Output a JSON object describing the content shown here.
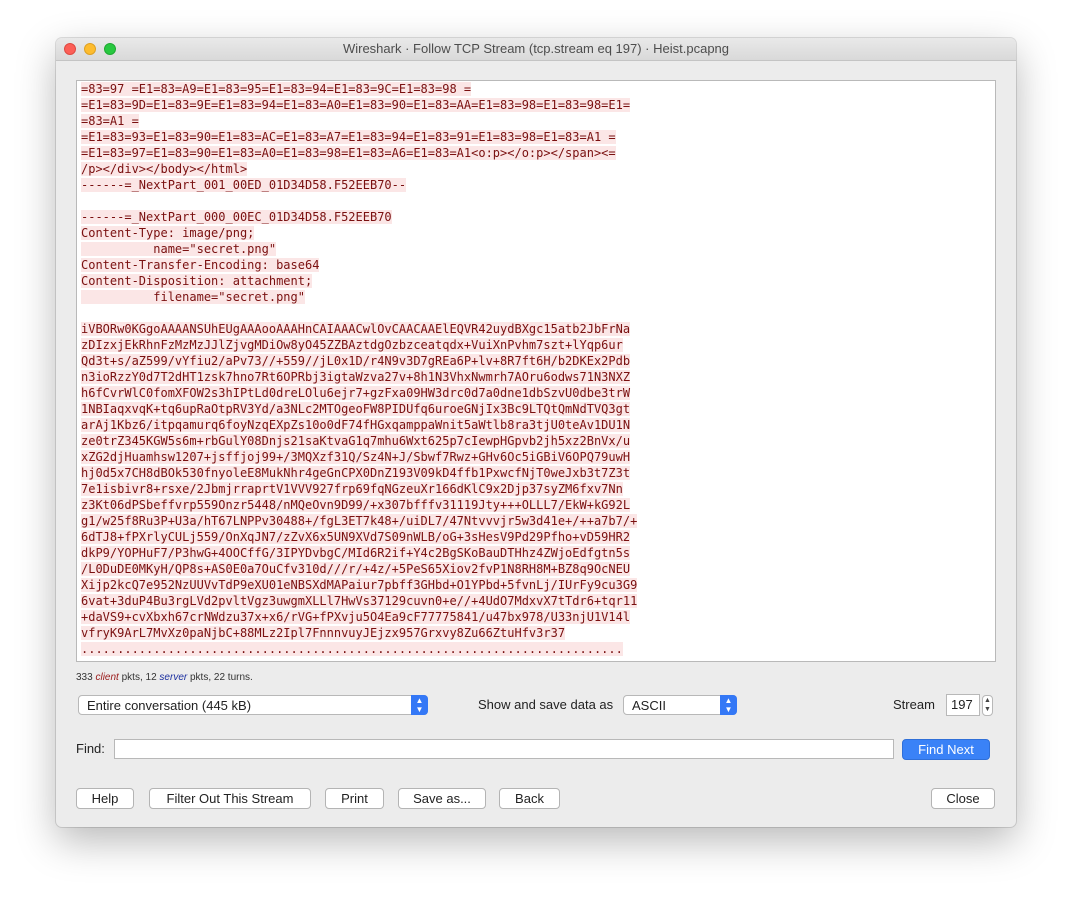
{
  "window": {
    "title": "Wireshark · Follow TCP Stream (tcp.stream eq 197) · Heist.pcapng"
  },
  "stream_lines": [
    "=83=97 =E1=83=A9=E1=83=95=E1=83=94=E1=83=9C=E1=83=98 =",
    "=E1=83=9D=E1=83=9E=E1=83=94=E1=83=A0=E1=83=90=E1=83=AA=E1=83=98=E1=83=98=E1=",
    "=83=A1 =",
    "=E1=83=93=E1=83=90=E1=83=AC=E1=83=A7=E1=83=94=E1=83=91=E1=83=98=E1=83=A1 =",
    "=E1=83=97=E1=83=90=E1=83=A0=E1=83=98=E1=83=A6=E1=83=A1<o:p></o:p></span><=",
    "/p></div></body></html>",
    "------=_NextPart_001_00ED_01D34D58.F52EEB70--",
    "",
    "------=_NextPart_000_00EC_01D34D58.F52EEB70",
    "Content-Type: image/png;",
    "          name=\"secret.png\"",
    "Content-Transfer-Encoding: base64",
    "Content-Disposition: attachment;",
    "          filename=\"secret.png\"",
    "",
    "iVBORw0KGgoAAAANSUhEUgAAAooAAAHnCAIAAACwlOvCAACAAElEQVR42uydBXgc15atb2JbFrNa",
    "zDIzxjEkRhnFzMzMzJJlZjvgMDiOw8yO45ZZBAztdgOzbzceatqdx+VuiXnPvhm7szt+lYqp6ur",
    "Qd3t+s/aZ599/vYfiu2/aPv73//+559//jL0x1D/r4N9v3D7gREa6P+lv+8R7ft6H/b2DKEx2Pdb",
    "n3ioRzzY0d7T2dHT1zsk7hno7Rt6OPRbj3igtaWzva27v+8h1N3VhxNwmrh7AOru6odws71N3NXZ",
    "h6fCvrWlC0fomXFOW2s3hIPtLd0dreLOlu6ejr7+gzFxa09HW3drc0d7a0dne1dbSzvU0dbe3trW",
    "1NBIaqxvqK+tq6upRaOtpRV3Yd/a3NLc2MTOgeoFW8PIDUfq6uroeGNjIx3Bc9LTQtQmNdTVQ3gt",
    "arAj1Kbz6/itpqamurq6foyNzqEXpZs10o0dF74fHGxqamppaWnit5aWtlb8ra3tjU0teAv1DU1N",
    "ze0trZ345KGW5s6m+rbGulY08Dnjs21saKtvaG1q7mhu6Wxt625p7cIewpHGpvb2jh5xz2BnVx/u",
    "xZG2djHuamhsw1207+jsffjoj99+/3MQXzf31Q/Sz4N+J/Sbwf7Rwz+GHv6Oc5iGBiV6OPQ79uwH",
    "hj0d5x7CH8dBOk530fnyoleE8MukNhr4geGnCPX0DnZ193V09kD4ffb1PxwcfNjT0weJxb3t7Z3t",
    "7e1isbivr8+rsxe/2JbmjrraprtV1VVV927frp69fqNGzeuXr166dKlC9x2Djp37syZM6fxv7Nn",
    "z3Kt06dPSbeffvrp559Onzr5448/nMQeOvn9D99/+x307bfffv31119Jty+++OLLL7/EkW+kG92L",
    "g1/w25f8Ru3P+U3a/hT67LNPPv30488+/fgL3ET7k48+/uiDL7/47Ntvvvjr5w3d41e+/++a7b7/+",
    "6dTJ8+fPXrlyCULj559/OnXqJN7/zZvX6x5UN9XVd7S09nWLB/oG+3sHesV9Pd29Pfho+vD59HR2",
    "dkP9/YOPHuF7/P3hwG+4OOCffG/3IPYDvbgC/MId6R2if+Y4c2BgSKoBauDTHhz4ZWjoEdfgtn5s",
    "/L0DuDE0MKyH/QP8s+AS0E0a7OuCfv310d///r/+4z/+5PeS65Xiov2fvP1N8RH8M+BZ8q9OcNEU",
    "Xijp2kcQ7e952NzUUVvTdP9eXU01eNBSXdMAPaiur7pbff3GHbd+O1YPbd+5fvnLj/IUrFy9cu3G9",
    "6vat+3duP4Bu3rgLVd2pvltVgz3uwgmXLLl7HwVs37129cuvn0+e//+4UdO7MdxvX7tTdr6+tqr11",
    "+daVS9+cvXbxh67crNWdzu37x+x6/rVG+fPXvju5O4Ea9cF77775841/u47bx978/U33njU1V14l",
    "vfryK9ArL7MvXz0paNjbC+88MLz2Ipl7FnnnvuyJEjzx957Grxvy8Zu66ZtuHfv3r37",
    "..........................................................................."
  ],
  "summary": {
    "client_count": "333",
    "client_label": "client",
    "mid": "pkts, 12",
    "server_label": "server",
    "tail": "pkts, 22 turns."
  },
  "conversation_select": {
    "value": "Entire conversation (445 kB)"
  },
  "show_save": {
    "label": "Show and save data as",
    "value": "ASCII"
  },
  "stream": {
    "label": "Stream",
    "value": "197"
  },
  "find": {
    "label": "Find:",
    "placeholder": "",
    "button": "Find Next"
  },
  "buttons": {
    "help": "Help",
    "filter_out": "Filter Out This Stream",
    "print": "Print",
    "save_as": "Save as...",
    "back": "Back",
    "close": "Close"
  }
}
